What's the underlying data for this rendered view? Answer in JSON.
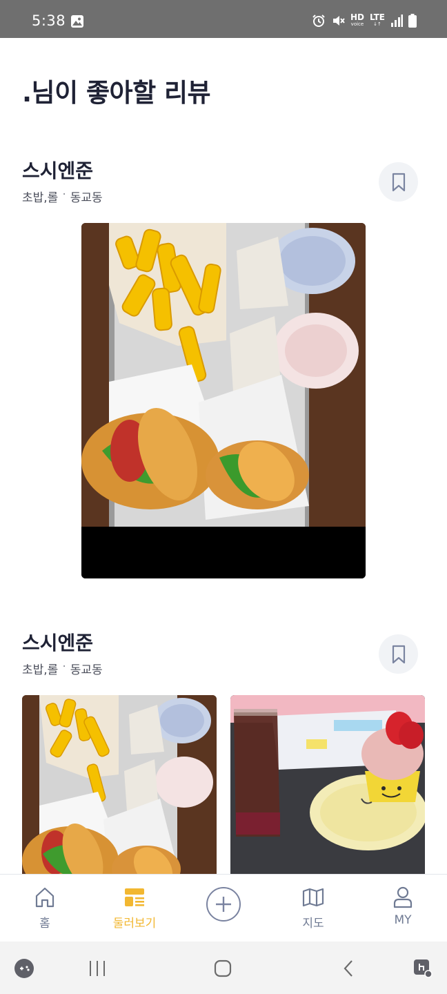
{
  "status_bar": {
    "time": "5:38",
    "hd_label": "HD",
    "hd_sub": "voice",
    "lte_label": "LTE"
  },
  "page": {
    "title": ".님이 좋아할 리뷰"
  },
  "reviews": [
    {
      "shop_name": "스시엔준",
      "category": "초밥,롤",
      "location": "동교동",
      "separator": "·",
      "photos": [
        "burger-fries-shakes-photo"
      ]
    },
    {
      "shop_name": "스시엔준",
      "category": "초밥,롤",
      "location": "동교동",
      "separator": "·",
      "photos": [
        "burger-fries-shakes-photo",
        "strawberry-donut-drink-photo"
      ]
    }
  ],
  "bottom_nav": {
    "items": [
      {
        "label": "홈",
        "icon": "home-icon"
      },
      {
        "label": "둘러보기",
        "icon": "explore-icon",
        "active": true
      },
      {
        "label": "",
        "icon": "add-icon"
      },
      {
        "label": "지도",
        "icon": "map-icon"
      },
      {
        "label": "MY",
        "icon": "profile-icon"
      }
    ]
  },
  "colors": {
    "accent": "#f2b731",
    "inactive": "#6f7a93",
    "title": "#1f2235",
    "status_bar": "#6f6f6f"
  }
}
